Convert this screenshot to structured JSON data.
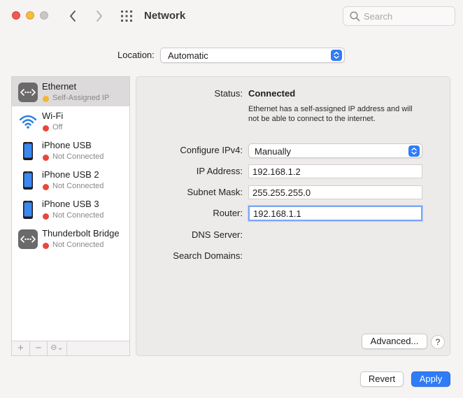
{
  "window": {
    "title": "Network"
  },
  "search": {
    "placeholder": "Search"
  },
  "location": {
    "label": "Location:",
    "value": "Automatic"
  },
  "services": [
    {
      "name": "Ethernet",
      "status": "Self-Assigned IP",
      "status_color": "#f5b630",
      "icon": "ethernet-icon",
      "selected": true
    },
    {
      "name": "Wi-Fi",
      "status": "Off",
      "status_color": "#e8473f",
      "icon": "wifi-icon",
      "selected": false
    },
    {
      "name": "iPhone USB",
      "status": "Not Connected",
      "status_color": "#e8473f",
      "icon": "iphone-icon",
      "selected": false
    },
    {
      "name": "iPhone USB 2",
      "status": "Not Connected",
      "status_color": "#e8473f",
      "icon": "iphone-icon",
      "selected": false
    },
    {
      "name": "iPhone USB 3",
      "status": "Not Connected",
      "status_color": "#e8473f",
      "icon": "iphone-icon",
      "selected": false
    },
    {
      "name": "Thunderbolt Bridge",
      "status": "Not Connected",
      "status_color": "#e8473f",
      "icon": "thunderbolt-bridge-icon",
      "selected": false
    }
  ],
  "sidebar_tools": {
    "add": "+",
    "remove": "−",
    "action": "⊖⌄"
  },
  "details": {
    "status_label": "Status:",
    "status_value": "Connected",
    "status_description": "Ethernet has a self-assigned IP address and will not be able to connect to the internet.",
    "configure_label": "Configure IPv4:",
    "configure_value": "Manually",
    "ip_label": "IP Address:",
    "ip_value": "192.168.1.2",
    "subnet_label": "Subnet Mask:",
    "subnet_value": "255.255.255.0",
    "router_label": "Router:",
    "router_value": "192.168.1.1",
    "dns_label": "DNS Server:",
    "search_domains_label": "Search Domains:",
    "advanced_label": "Advanced...",
    "help_label": "?"
  },
  "footer": {
    "revert_label": "Revert",
    "apply_label": "Apply"
  },
  "colors": {
    "accent": "#2f7cf6",
    "warning": "#f5b630",
    "error": "#e8473f"
  }
}
